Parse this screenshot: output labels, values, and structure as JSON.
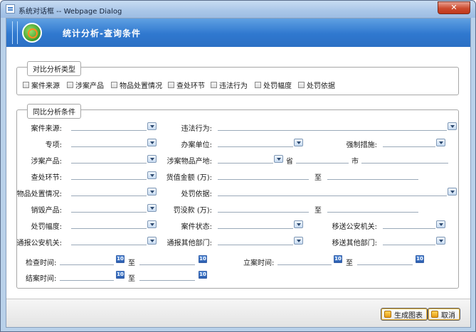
{
  "window": {
    "title": "系统对话框 -- Webpage Dialog",
    "close_label": "✕"
  },
  "header": {
    "title": "统计分析-查询条件"
  },
  "compare_group": {
    "legend": "对比分析类型",
    "options": [
      {
        "label": "案件来源",
        "checked": false
      },
      {
        "label": "涉案产品",
        "checked": false
      },
      {
        "label": "物品处置情况",
        "checked": false
      },
      {
        "label": "查处环节",
        "checked": false
      },
      {
        "label": "违法行为",
        "checked": false
      },
      {
        "label": "处罚幅度",
        "checked": false
      },
      {
        "label": "处罚依据",
        "checked": false
      }
    ]
  },
  "conditions_group": {
    "legend": "同比分析条件",
    "fields": {
      "case_source": {
        "label": "案件来源:",
        "value": ""
      },
      "violation": {
        "label": "违法行为:",
        "value": ""
      },
      "special": {
        "label": "专项:",
        "value": ""
      },
      "handling_unit": {
        "label": "办案单位:",
        "value": ""
      },
      "enforcement": {
        "label": "强制措施:",
        "value": ""
      },
      "product": {
        "label": "涉案产品:",
        "value": ""
      },
      "origin": {
        "label": "涉案物品产地:",
        "value": "",
        "province": "省",
        "city": "市"
      },
      "stage": {
        "label": "查处环节:",
        "value": ""
      },
      "goods_value": {
        "label": "货值金额 (万):",
        "to": "至"
      },
      "disposal": {
        "label": "物品处置情况:",
        "value": ""
      },
      "penalty_basis": {
        "label": "处罚依据:",
        "value": ""
      },
      "destroyed": {
        "label": "销毁产品:",
        "value": ""
      },
      "fine": {
        "label": "罚没款 (万):",
        "to": "至"
      },
      "penalty_range": {
        "label": "处罚幅度:",
        "value": ""
      },
      "case_status": {
        "label": "案件状态:",
        "value": ""
      },
      "transfer_police": {
        "label": "移送公安机关:",
        "value": ""
      },
      "notify_police": {
        "label": "通报公安机关:",
        "value": ""
      },
      "notify_other": {
        "label": "通报其他部门:",
        "value": ""
      },
      "transfer_other": {
        "label": "移送其他部门:",
        "value": ""
      },
      "check_time": {
        "label": "检查时间:",
        "to": "至"
      },
      "filing_time": {
        "label": "立案时间:",
        "to": "至"
      },
      "close_time": {
        "label": "结案时间:",
        "to": "至"
      }
    },
    "calendar_icon_text": "10"
  },
  "footer": {
    "generate_label": "生成图表",
    "cancel_label": "取消"
  }
}
